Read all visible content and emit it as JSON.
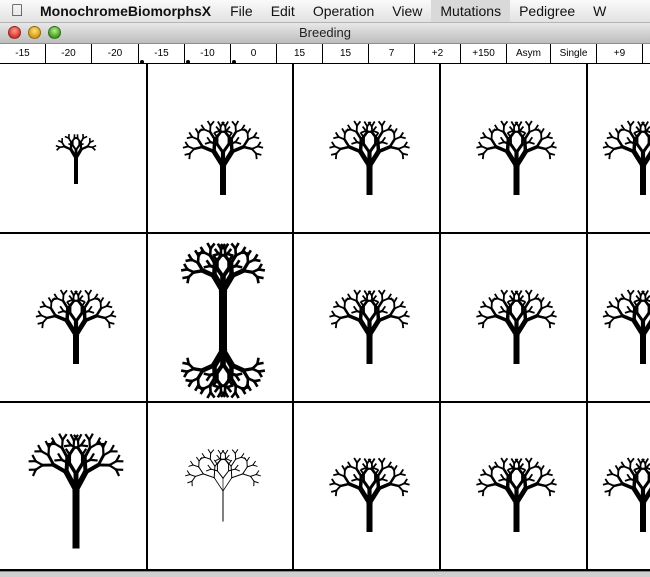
{
  "menubar": {
    "apple": "",
    "app_name": "MonochromeBiomorphsX",
    "items": [
      "File",
      "Edit",
      "Operation",
      "View",
      "Mutations",
      "Pedigree",
      "W"
    ]
  },
  "window": {
    "title": "Breeding"
  },
  "genes": [
    "-15",
    "-20",
    "-20",
    "-15",
    "-10",
    "0",
    "15",
    "15",
    "7",
    "+2",
    "+150",
    "Asym",
    "Single",
    "+9"
  ],
  "biomorphs": [
    {
      "name": "biomorph-r1c1",
      "variant": "small"
    },
    {
      "name": "biomorph-r1c2",
      "variant": "standard"
    },
    {
      "name": "biomorph-r1c3",
      "variant": "standard"
    },
    {
      "name": "biomorph-r1c4",
      "variant": "standard"
    },
    {
      "name": "biomorph-r1c5",
      "variant": "standard"
    },
    {
      "name": "biomorph-r2c1",
      "variant": "standard"
    },
    {
      "name": "biomorph-r2c2",
      "variant": "mirrored"
    },
    {
      "name": "biomorph-r2c3",
      "variant": "standard"
    },
    {
      "name": "biomorph-r2c4",
      "variant": "standard"
    },
    {
      "name": "biomorph-r2c5",
      "variant": "standard"
    },
    {
      "name": "biomorph-r3c1",
      "variant": "tall"
    },
    {
      "name": "biomorph-r3c2",
      "variant": "thin"
    },
    {
      "name": "biomorph-r3c3",
      "variant": "standard"
    },
    {
      "name": "biomorph-r3c4",
      "variant": "standard"
    },
    {
      "name": "biomorph-r3c5",
      "variant": "standard"
    }
  ]
}
